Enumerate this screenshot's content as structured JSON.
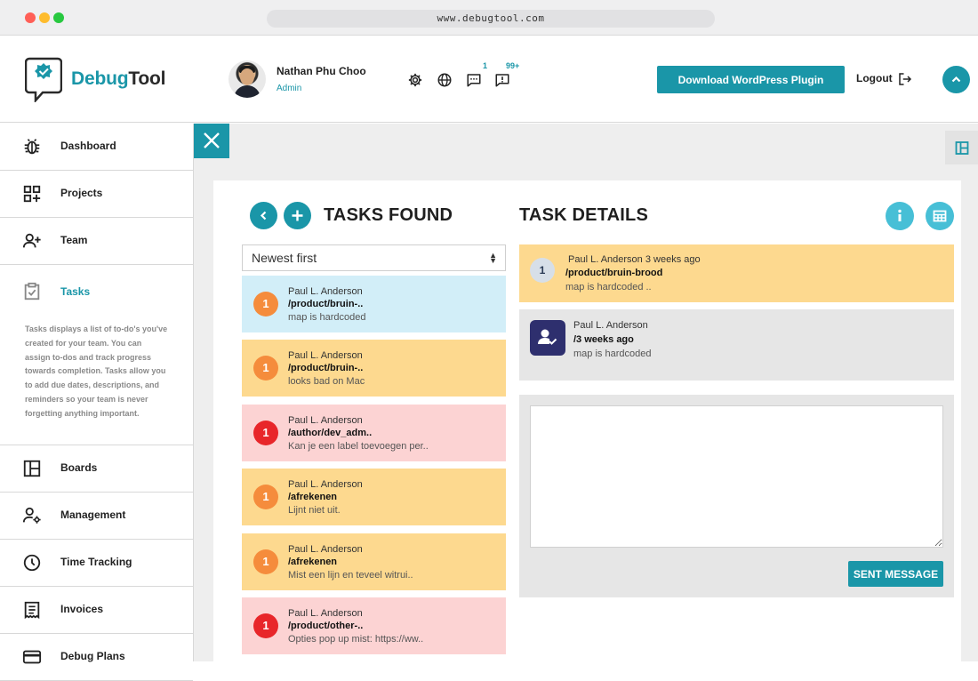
{
  "browser": {
    "url": "www.debugtool.com"
  },
  "brand": {
    "name_part1": "Debug",
    "name_part2": "Tool",
    "accent_color": "#1a96a8"
  },
  "user": {
    "name": "Nathan Phu Choo",
    "role": "Admin"
  },
  "header": {
    "icons": [
      "gear-icon",
      "globe-icon",
      "chat-icon",
      "alert-message-icon"
    ],
    "chat_badge": "1",
    "alert_badge": "99+",
    "plugin_button": "Download WordPress Plugin",
    "logout": "Logout"
  },
  "sidebar": {
    "items": [
      {
        "label": "Dashboard",
        "icon": "bug-icon"
      },
      {
        "label": "Projects",
        "icon": "grid-plus-icon"
      },
      {
        "label": "Team",
        "icon": "user-plus-icon"
      },
      {
        "label": "Tasks",
        "icon": "checklist-icon",
        "active": true
      },
      {
        "label": "Boards",
        "icon": "board-icon"
      },
      {
        "label": "Management",
        "icon": "user-gear-icon"
      },
      {
        "label": "Time Tracking",
        "icon": "clock-icon"
      },
      {
        "label": "Invoices",
        "icon": "invoice-icon"
      },
      {
        "label": "Debug Plans",
        "icon": "card-icon"
      }
    ],
    "tasks_description": "Tasks displays a list of to-do's you've created for your team. You can assign to-dos and track progress towards completion. Tasks allow you to add due dates, descriptions, and reminders so your team is never forgetting anything important."
  },
  "tasks": {
    "title": "TASKS FOUND",
    "sort_value": "Newest first",
    "items": [
      {
        "num": "1",
        "author": "Paul L. Anderson",
        "path": "/product/bruin-..",
        "desc": "map is hardcoded",
        "color": "blue"
      },
      {
        "num": "1",
        "author": "Paul L. Anderson",
        "path": "/product/bruin-..",
        "desc": "looks bad on Mac",
        "color": "yellow"
      },
      {
        "num": "1",
        "author": "Paul L. Anderson",
        "path": "/author/dev_adm..",
        "desc": "Kan je een label toevoegen per..",
        "color": "pink"
      },
      {
        "num": "1",
        "author": "Paul L. Anderson",
        "path": "/afrekenen",
        "desc": "Lijnt niet uit.",
        "color": "yellow"
      },
      {
        "num": "1",
        "author": "Paul L. Anderson",
        "path": "/afrekenen",
        "desc": "Mist een lijn en teveel witrui..",
        "color": "yellow"
      },
      {
        "num": "1",
        "author": "Paul L. Anderson",
        "path": "/product/other-..",
        "desc": "Opties pop up mist: https://ww..",
        "color": "pink"
      }
    ]
  },
  "details": {
    "title": "TASK DETAILS",
    "summary": {
      "num": "1",
      "author": "Paul L. Anderson 3 weeks ago",
      "path": "/product/bruin-brood",
      "desc": "map is hardcoded .."
    },
    "comment": {
      "author": "Paul L. Anderson",
      "time": "/3 weeks ago",
      "desc": "map is hardcoded"
    },
    "send_button": "SENT MESSAGE",
    "message_value": ""
  }
}
